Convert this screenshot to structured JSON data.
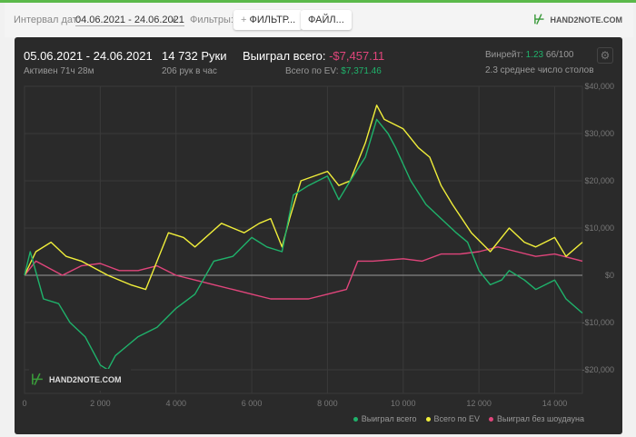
{
  "toolbar": {
    "date_label": "Интервал дат:",
    "date_value": "04.06.2021 - 24.06.2021",
    "filters_label": "Фильтры:",
    "filter_button": "ФИЛЬТР...",
    "file_button": "ФАЙЛ...",
    "logo": "HAND2NOTE.COM"
  },
  "summary": {
    "range": "05.06.2021 - 24.06.2021",
    "active": "Активен 71ч 28м",
    "hands": "14 732 Руки",
    "per_hour": "206 рук в час",
    "won_label": "Выиграл всего:",
    "won_value": "-$7,457.11",
    "ev_label": "Всего по EV:",
    "ev_value": "$7,371.46",
    "winrate_label": "Винрейт:",
    "winrate_value": "1.23",
    "winrate_rest": "66/100",
    "tables": "2.3 среднее число столов"
  },
  "colors": {
    "green": "#1fb26b",
    "yellow": "#f0ee3a",
    "pink": "#e0457b",
    "negative": "#e0457b"
  },
  "chart_data": {
    "type": "line",
    "watermark": "HAND2NOTE.COM",
    "xlim": [
      0,
      14732
    ],
    "ylim": [
      -25000,
      40000
    ],
    "xticks": [
      {
        "v": 0,
        "l": "0"
      },
      {
        "v": 2000,
        "l": "2 000"
      },
      {
        "v": 4000,
        "l": "4 000"
      },
      {
        "v": 6000,
        "l": "6 000"
      },
      {
        "v": 8000,
        "l": "8 000"
      },
      {
        "v": 10000,
        "l": "10 000"
      },
      {
        "v": 12000,
        "l": "12 000"
      },
      {
        "v": 14000,
        "l": "14 000"
      }
    ],
    "yticks": [
      {
        "v": 40000,
        "l": "$40,000"
      },
      {
        "v": 30000,
        "l": "$30,000"
      },
      {
        "v": 20000,
        "l": "$20,000"
      },
      {
        "v": 10000,
        "l": "$10,000"
      },
      {
        "v": 0,
        "l": "$0"
      },
      {
        "v": -10000,
        "l": "-$10,000"
      },
      {
        "v": -20000,
        "l": "-$20,000"
      }
    ],
    "series": [
      {
        "name": "Выиграл всего",
        "color": "#1fb26b",
        "x": [
          0,
          150,
          500,
          900,
          1200,
          1600,
          2000,
          2200,
          2400,
          2700,
          3000,
          3500,
          4000,
          4500,
          5000,
          5500,
          6000,
          6400,
          6800,
          7100,
          7500,
          8000,
          8300,
          8600,
          9000,
          9300,
          9600,
          9800,
          10200,
          10600,
          11000,
          11400,
          11700,
          12000,
          12300,
          12600,
          12800,
          13200,
          13500,
          14000,
          14300,
          14732
        ],
        "y": [
          0,
          5000,
          -5000,
          -6000,
          -10000,
          -13000,
          -19000,
          -20000,
          -17000,
          -15000,
          -13000,
          -11000,
          -7000,
          -4000,
          3000,
          4000,
          8000,
          6000,
          5000,
          17000,
          19000,
          21000,
          16000,
          20000,
          25000,
          33000,
          30000,
          27000,
          20000,
          15000,
          12000,
          9000,
          7000,
          1000,
          -2000,
          -1000,
          1000,
          -1000,
          -3000,
          -1000,
          -5000,
          -8000
        ]
      },
      {
        "name": "Всего по EV",
        "color": "#f0ee3a",
        "x": [
          0,
          300,
          700,
          1100,
          1500,
          2200,
          2800,
          3200,
          3600,
          3800,
          4200,
          4500,
          5200,
          5800,
          6200,
          6500,
          6800,
          7000,
          7300,
          8000,
          8300,
          8600,
          9000,
          9300,
          9500,
          10000,
          10400,
          10700,
          11000,
          11300,
          11800,
          12300,
          12800,
          13200,
          13500,
          14000,
          14300,
          14732
        ],
        "y": [
          0,
          5000,
          7000,
          4000,
          3000,
          0,
          -2000,
          -3000,
          5000,
          9000,
          8000,
          6000,
          11000,
          9000,
          11000,
          12000,
          6000,
          12000,
          20000,
          22000,
          19000,
          20000,
          28000,
          36000,
          33000,
          31000,
          27000,
          25000,
          19000,
          15000,
          9000,
          5000,
          10000,
          7000,
          6000,
          8000,
          4000,
          7000
        ]
      },
      {
        "name": "Выиграл без шоудауна",
        "color": "#e0457b",
        "x": [
          0,
          300,
          1000,
          1500,
          2000,
          2500,
          3000,
          3500,
          4000,
          4500,
          5000,
          5500,
          6000,
          6500,
          7000,
          7500,
          8000,
          8500,
          8800,
          9200,
          10000,
          10500,
          11000,
          11500,
          12000,
          12500,
          13000,
          13500,
          14000,
          14732
        ],
        "y": [
          0,
          3000,
          0,
          2000,
          2500,
          1000,
          1000,
          2000,
          0,
          -1000,
          -2000,
          -3000,
          -4000,
          -5000,
          -5000,
          -5000,
          -4000,
          -3000,
          3000,
          3000,
          3500,
          3000,
          4500,
          4500,
          5000,
          6000,
          5000,
          4000,
          4500,
          3000
        ]
      }
    ]
  }
}
